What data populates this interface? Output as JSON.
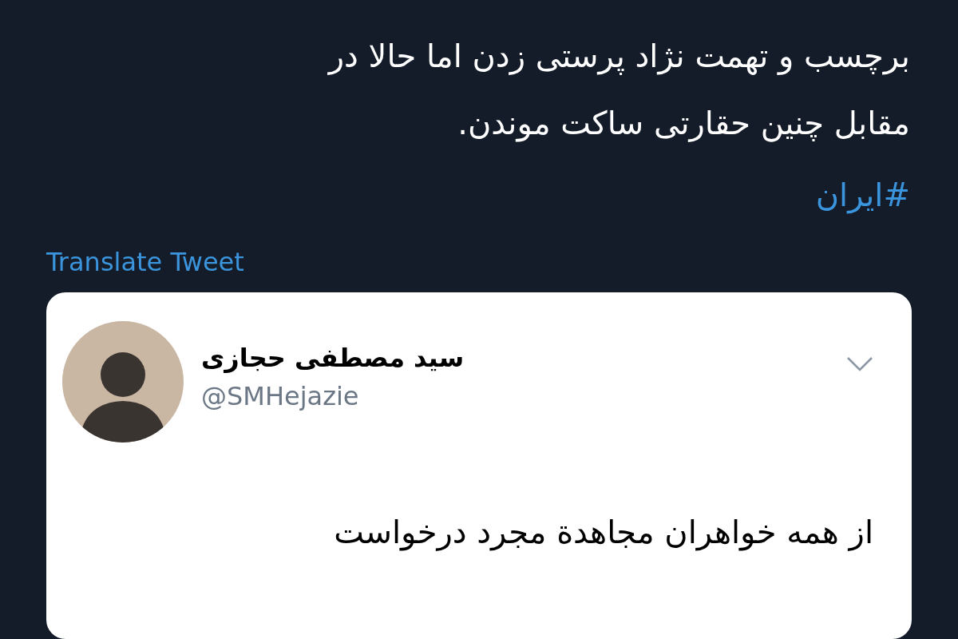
{
  "tweet": {
    "text_lines": [
      "برچسب و تهمت نژاد پرستی زدن اما حالا در",
      "مقابل چنین حقارتی ساکت موندن."
    ],
    "hashtag": "#ایران",
    "translate_link": "Translate Tweet"
  },
  "quoted_tweet": {
    "name": "سید مصطفی حجازی",
    "handle": "@SMHejazie",
    "text_lines": [
      "از همه خواهران مجاهدة مجرد درخواست"
    ]
  }
}
